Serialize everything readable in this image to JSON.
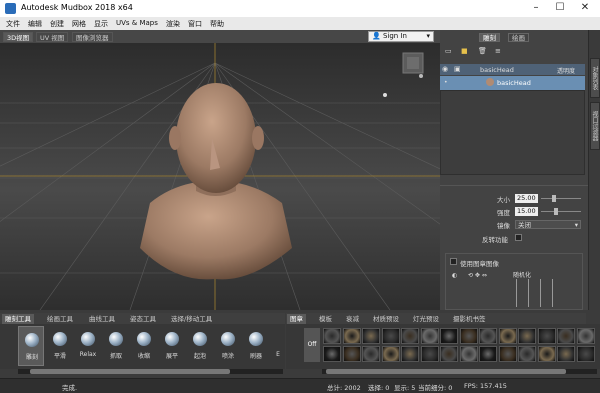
{
  "window": {
    "title": "Autodesk Mudbox 2018 x64",
    "min": "–",
    "max": "☐",
    "close": "✕"
  },
  "menu": [
    "文件",
    "编辑",
    "创建",
    "网格",
    "显示",
    "UVs & Maps",
    "渲染",
    "窗口",
    "帮助"
  ],
  "view_tabs": [
    {
      "label": "3D视图",
      "active": true
    },
    {
      "label": "UV 视图",
      "active": false
    },
    {
      "label": "图像浏览器",
      "active": false
    }
  ],
  "signin": {
    "label": "Sign In",
    "icon": "person-icon"
  },
  "right_panel": {
    "tabs": [
      {
        "label": "雕刻",
        "active": true
      },
      {
        "label": "绘画",
        "active": false
      }
    ],
    "layer_header": {
      "name": "basicHead",
      "col": "透明度"
    },
    "layer_row": {
      "name": "basicHead"
    },
    "props": [
      {
        "label": "大小",
        "value": "25.00",
        "fraction": 0.1
      },
      {
        "label": "强度",
        "value": "15.00",
        "fraction": 0.15
      },
      {
        "label": "镜像",
        "value": "关闭"
      },
      {
        "label": "反转功能",
        "value": ""
      }
    ],
    "stamp_group": {
      "label": "使用图章图像",
      "sub": "随机化"
    }
  },
  "side_tabs": [
    "对象列表",
    "视口过滤器"
  ],
  "tool_tabs": [
    {
      "label": "雕刻工具",
      "active": true
    },
    {
      "label": "绘画工具",
      "active": false
    },
    {
      "label": "曲线工具",
      "active": false
    },
    {
      "label": "姿态工具",
      "active": false
    },
    {
      "label": "选择/移动工具",
      "active": false
    }
  ],
  "tools": [
    "雕刻",
    "平滑",
    "Relax",
    "抓取",
    "收缩",
    "展平",
    "起泡",
    "喷涂",
    "刷器",
    "E"
  ],
  "stamp_tabs": [
    {
      "label": "图章",
      "active": true
    },
    {
      "label": "模板",
      "active": false
    },
    {
      "label": "衰减",
      "active": false
    },
    {
      "label": "材质预设",
      "active": false
    },
    {
      "label": "灯光预设",
      "active": false
    },
    {
      "label": "摄影机书签",
      "active": false
    }
  ],
  "stamp_off": "Off",
  "status": {
    "left": "完成.",
    "total": "总计: 2002",
    "selected": "选择: 0",
    "shown": "显示: 5",
    "subdiv": "当前细分: 0",
    "fps": "FPS: 157.415"
  },
  "colors": {
    "accent": "#6a8fb3",
    "head": "#b08b73"
  }
}
